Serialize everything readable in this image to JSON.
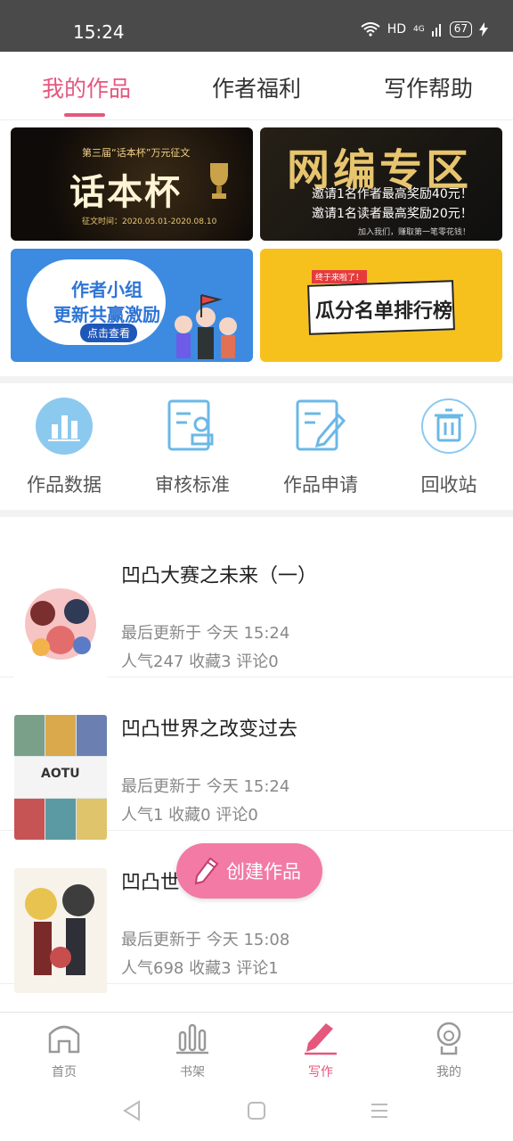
{
  "status_bar": {
    "time": "15:24",
    "network": "HD",
    "signal": "4G",
    "battery": "67"
  },
  "tabs": [
    {
      "label": "我的作品",
      "active": true
    },
    {
      "label": "作者福利",
      "active": false
    },
    {
      "label": "写作帮助",
      "active": false
    }
  ],
  "banners": {
    "b1": {
      "small": "第三届“话本杯”万元征文",
      "big": "话本杯",
      "date": "征文时间：2020.05.01-2020.08.10"
    },
    "b2": {
      "title": "网编专区",
      "line1": "邀请1名作者最高奖励40元！",
      "line2": "邀请1名读者最高奖励20元！",
      "line3": "加入我们，赚取第一笔零花钱！"
    },
    "b3": {
      "t1": "作者小组",
      "t2": "更新共赢激励",
      "btn": "点击查看"
    },
    "b4": {
      "tag": "终于来啦了！",
      "text": "瓜分名单排行榜"
    }
  },
  "shortcuts": [
    {
      "label": "作品数据",
      "icon": "bar-chart-icon"
    },
    {
      "label": "审核标准",
      "icon": "review-document-icon"
    },
    {
      "label": "作品申请",
      "icon": "edit-document-icon"
    },
    {
      "label": "回收站",
      "icon": "trash-icon"
    }
  ],
  "works": [
    {
      "title": "凹凸大赛之未来（一）",
      "updated": "最后更新于 今天 15:24",
      "stats": "人气247 收藏3 评论0"
    },
    {
      "title": "凹凸世界之改变过去",
      "updated": "最后更新于 今天 15:24",
      "stats": "人气1 收藏0 评论0"
    },
    {
      "title": "凹凸世",
      "updated": "最后更新于 今天 15:08",
      "stats": "人气698 收藏3 评论1"
    }
  ],
  "cover2_text": "AOTU",
  "fab": {
    "label": "创建作品"
  },
  "bottom_nav": [
    {
      "label": "首页",
      "icon": "home-icon"
    },
    {
      "label": "书架",
      "icon": "bookshelf-icon"
    },
    {
      "label": "写作",
      "icon": "pen-icon",
      "active": true
    },
    {
      "label": "我的",
      "icon": "profile-icon"
    }
  ],
  "colors": {
    "accent": "#e5577c",
    "fab": "#f27aa5",
    "icon_blue": "#6bb8e6"
  }
}
